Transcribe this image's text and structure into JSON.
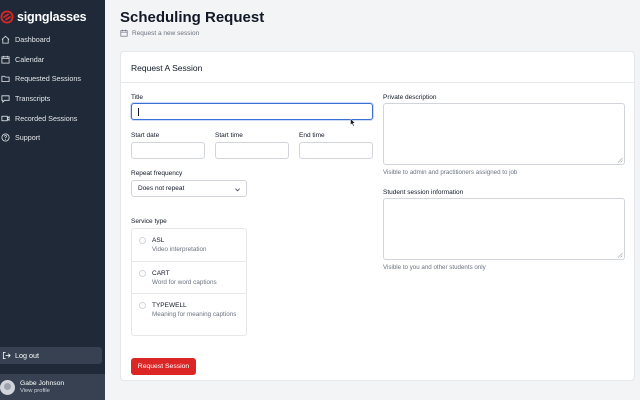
{
  "brand": {
    "name": "signglasses",
    "accent": "#dc2626"
  },
  "sidebar": {
    "items": [
      {
        "label": "Dashboard",
        "icon": "home-icon"
      },
      {
        "label": "Calendar",
        "icon": "calendar-icon"
      },
      {
        "label": "Requested Sessions",
        "icon": "folder-icon"
      },
      {
        "label": "Transcripts",
        "icon": "chat-icon"
      },
      {
        "label": "Recorded Sessions",
        "icon": "video-icon"
      },
      {
        "label": "Support",
        "icon": "help-icon"
      }
    ],
    "logout_label": "Log out",
    "user": {
      "name": "Gabe Johnson",
      "link": "View profile"
    }
  },
  "header": {
    "title": "Scheduling Request",
    "subtitle": "Request a new session"
  },
  "form": {
    "card_title": "Request A Session",
    "title_label": "Title",
    "title_value": "",
    "start_date_label": "Start date",
    "start_time_label": "Start time",
    "end_time_label": "End time",
    "repeat_label": "Repeat frequency",
    "repeat_value": "Does not repeat",
    "service_label": "Service type",
    "services": [
      {
        "name": "ASL",
        "desc": "Video interpretation"
      },
      {
        "name": "CART",
        "desc": "Word for word captions"
      },
      {
        "name": "TYPEWELL",
        "desc": "Meaning for meaning captions"
      }
    ],
    "private_label": "Private description",
    "private_hint": "Visible to admin and practitioners assigned to job",
    "student_label": "Student session information",
    "student_hint": "Visible to you and other students only",
    "submit_label": "Request Session"
  }
}
